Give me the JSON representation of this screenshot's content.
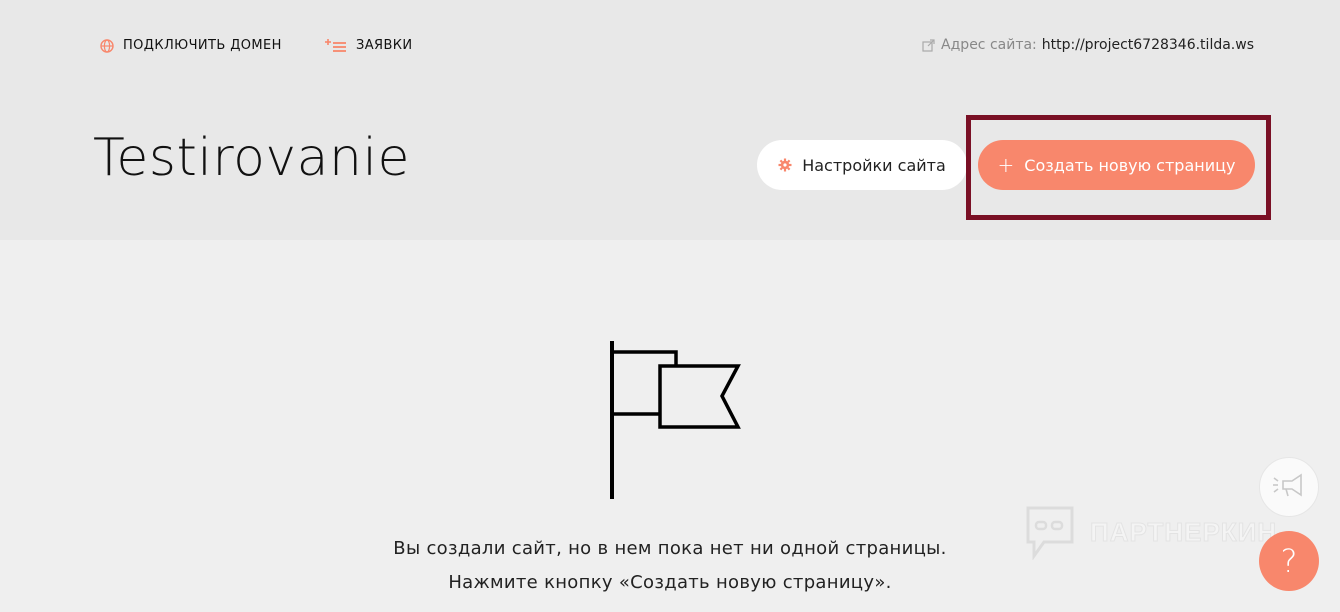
{
  "topnav": {
    "domain_label": "ПОДКЛЮЧИТЬ ДОМЕН",
    "leads_label": "ЗАЯВКИ",
    "address_label": "Адрес сайта:",
    "address_url": "http://project6728346.tilda.ws"
  },
  "project": {
    "title": "Testirovanie"
  },
  "actions": {
    "settings_label": "Настройки сайта",
    "create_plus": "+",
    "create_label": "Создать новую страницу"
  },
  "empty_state": {
    "line1": "Вы создали сайт, но в нем пока нет ни одной страницы.",
    "line2": "Нажмите кнопку «Создать новую страницу»."
  },
  "watermark": {
    "text": "ПАРТНЕРКИН"
  },
  "help": {
    "symbol": "?"
  },
  "colors": {
    "accent": "#f8876c",
    "highlight_frame": "#7a1025",
    "header_bg": "#e8e8e8",
    "page_bg": "#efefef"
  },
  "icons": [
    "globe-icon",
    "list-plus-icon",
    "external-link-icon",
    "gear-icon",
    "flag-icon",
    "megaphone-icon",
    "question-icon"
  ]
}
